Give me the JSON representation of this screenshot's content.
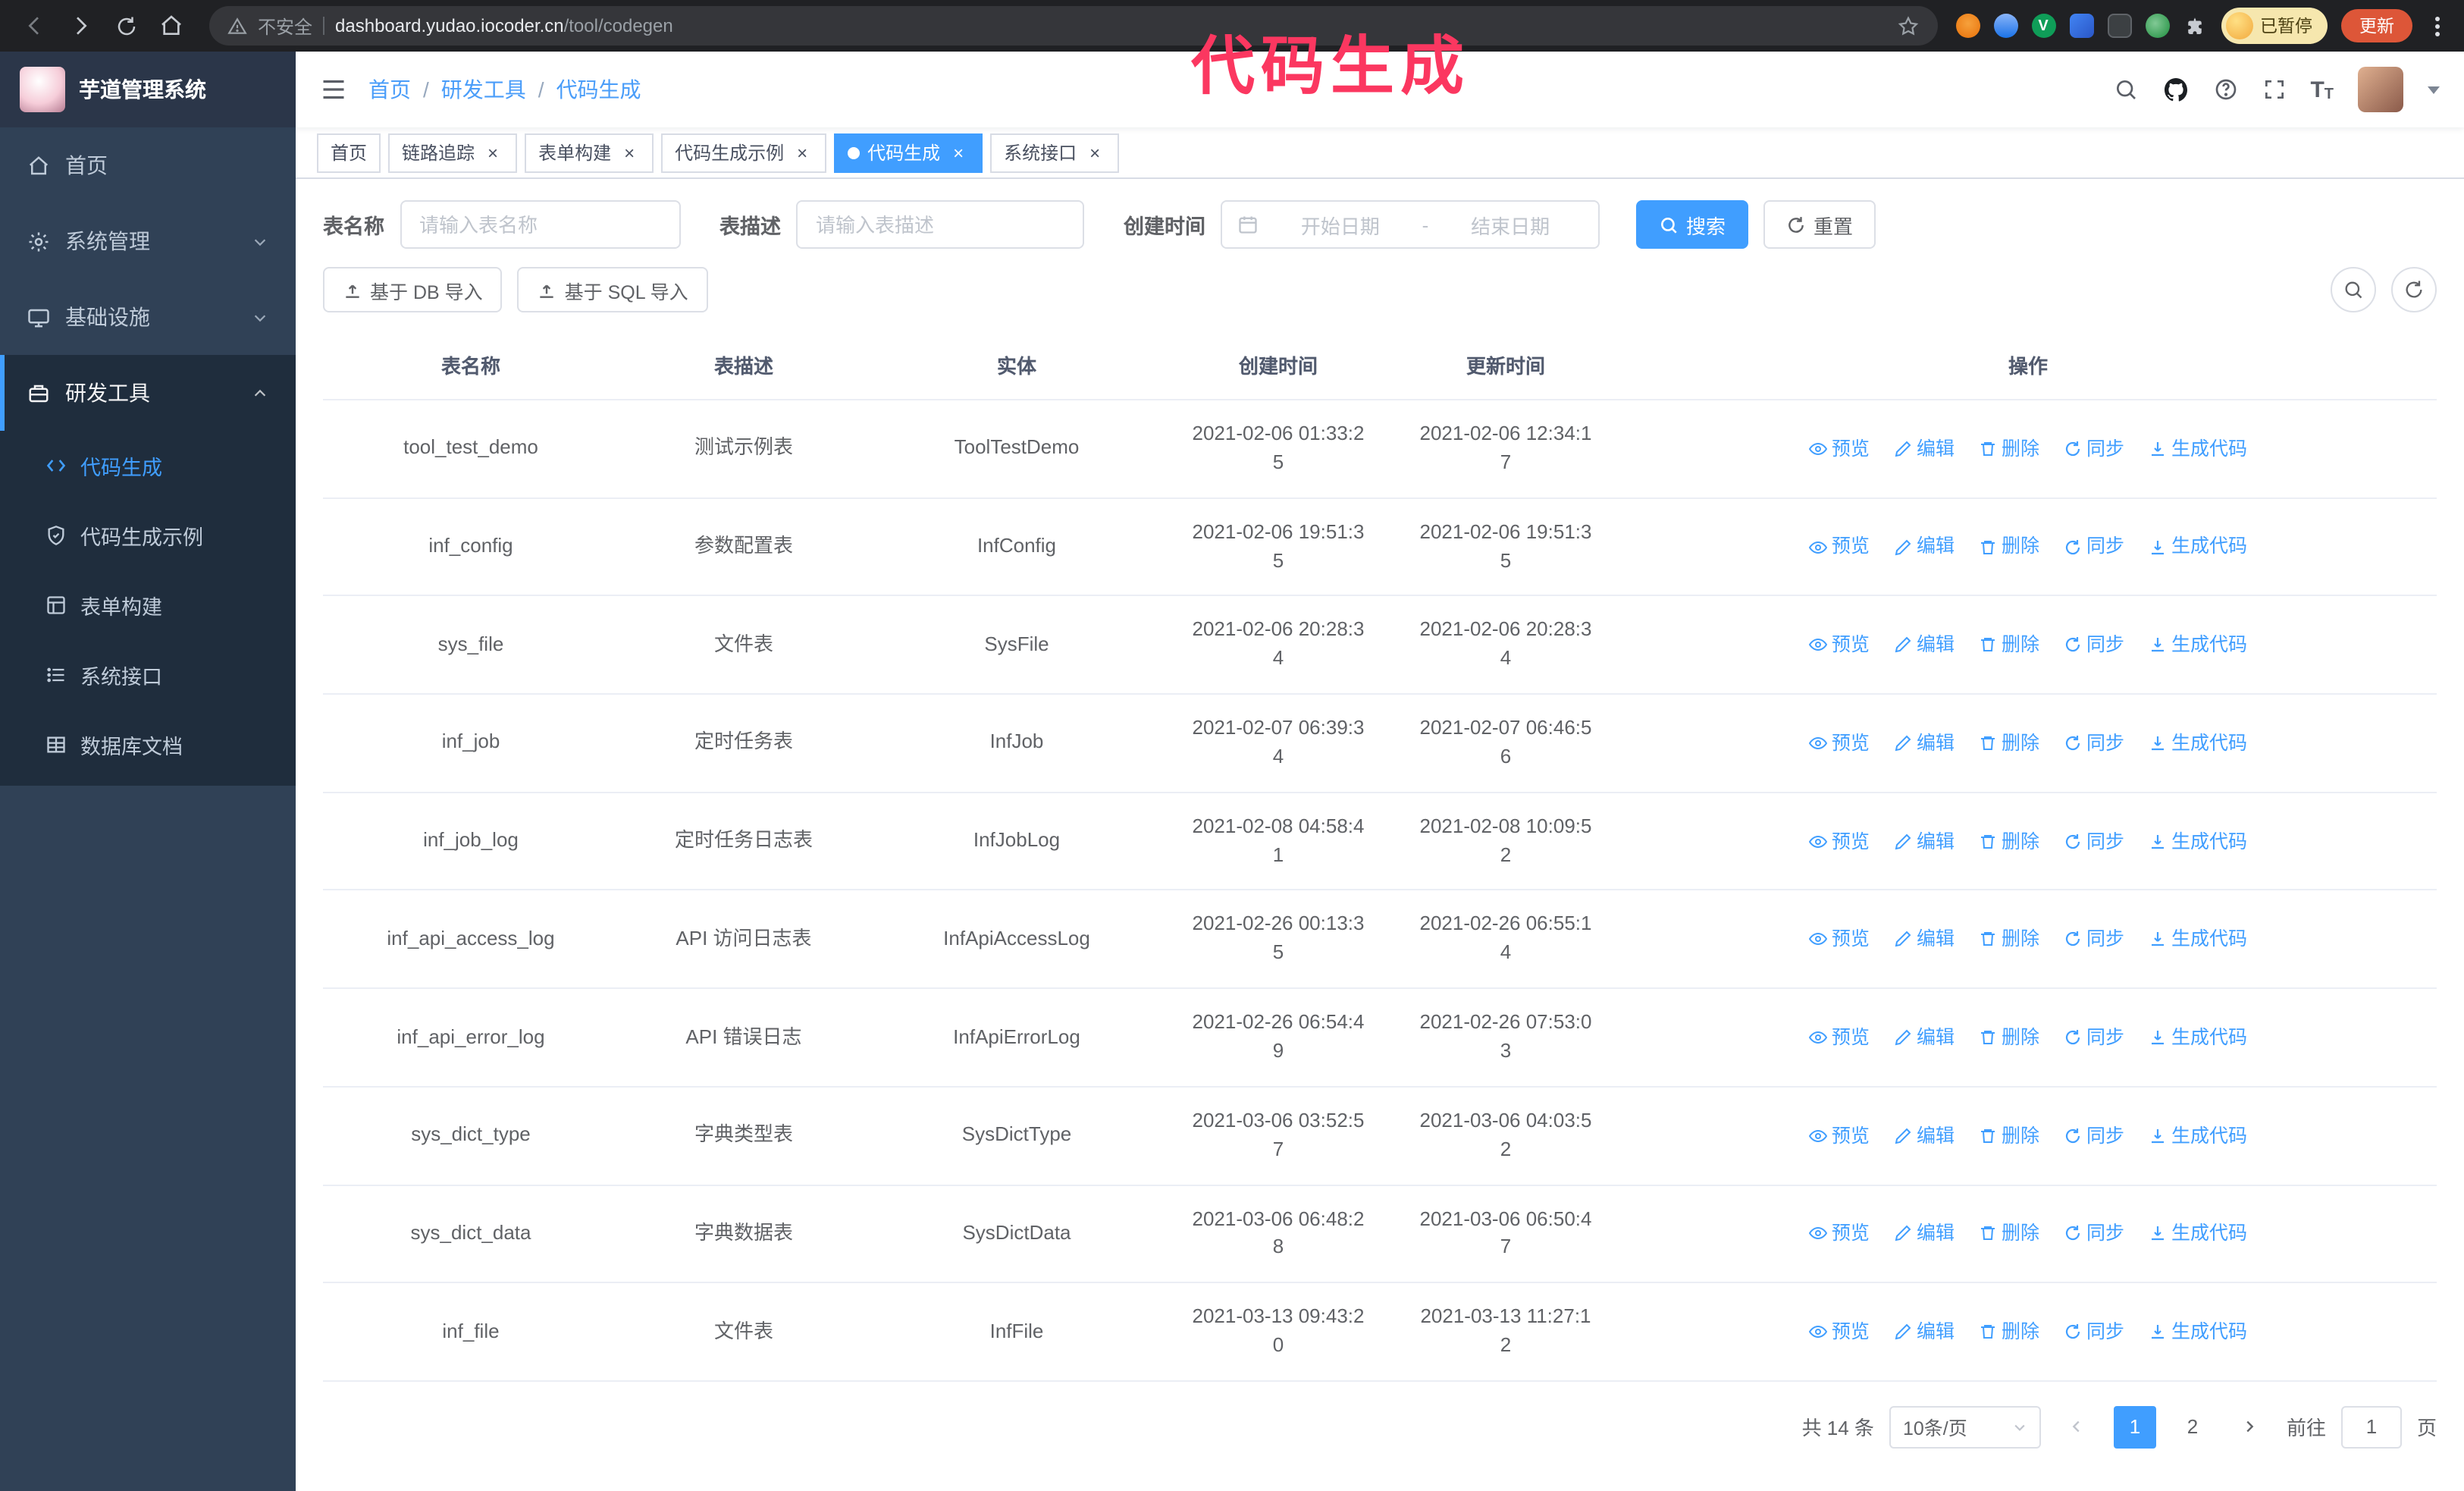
{
  "annotation": {
    "text": "代码生成",
    "color": "#fb3760"
  },
  "icons": {
    "close": "×"
  },
  "colors": {
    "accent": "#409EFF",
    "sidebar_bg": "#304156",
    "submenu_bg": "#1f2d3d",
    "update_button": "#dd5638"
  },
  "browser": {
    "security_label": "不安全",
    "url_host": "dashboard.yudao.iocoder.cn",
    "url_path": "/tool/codegen",
    "paused_badge": "已暂停",
    "update_button": "更新"
  },
  "sidebar": {
    "logo_title": "芋道管理系统",
    "items": [
      {
        "label": "首页",
        "icon": "home-icon"
      },
      {
        "label": "系统管理",
        "icon": "gear-icon"
      },
      {
        "label": "基础设施",
        "icon": "monitor-icon"
      },
      {
        "label": "研发工具",
        "icon": "toolbox-icon"
      }
    ],
    "submenu": [
      {
        "label": "代码生成",
        "icon": "code-icon",
        "active": true
      },
      {
        "label": "代码生成示例",
        "icon": "shield-icon"
      },
      {
        "label": "表单构建",
        "icon": "form-icon"
      },
      {
        "label": "系统接口",
        "icon": "list-icon"
      },
      {
        "label": "数据库文档",
        "icon": "table-grid-icon"
      }
    ]
  },
  "header": {
    "breadcrumb": [
      "首页",
      "研发工具",
      "代码生成"
    ],
    "separator": "/"
  },
  "tabs": [
    {
      "label": "首页",
      "closable": false
    },
    {
      "label": "链路追踪",
      "closable": true
    },
    {
      "label": "表单构建",
      "closable": true
    },
    {
      "label": "代码生成示例",
      "closable": true
    },
    {
      "label": "代码生成",
      "closable": true,
      "active": true
    },
    {
      "label": "系统接口",
      "closable": true
    }
  ],
  "filters": {
    "table_name_label": "表名称",
    "table_name_placeholder": "请输入表名称",
    "table_desc_label": "表描述",
    "table_desc_placeholder": "请输入表描述",
    "create_time_label": "创建时间",
    "date_start_placeholder": "开始日期",
    "date_separator": "-",
    "date_end_placeholder": "结束日期",
    "search_button": "搜索",
    "reset_button": "重置"
  },
  "toolbar": {
    "import_db_button": "基于 DB 导入",
    "import_sql_button": "基于 SQL 导入"
  },
  "table": {
    "columns": [
      "表名称",
      "表描述",
      "实体",
      "创建时间",
      "更新时间",
      "操作"
    ],
    "actions": [
      "预览",
      "编辑",
      "删除",
      "同步",
      "生成代码"
    ],
    "rows": [
      {
        "name": "tool_test_demo",
        "desc": "测试示例表",
        "entity": "ToolTestDemo",
        "created": "2021-02-06 01:33:25",
        "updated": "2021-02-06 12:34:17"
      },
      {
        "name": "inf_config",
        "desc": "参数配置表",
        "entity": "InfConfig",
        "created": "2021-02-06 19:51:35",
        "updated": "2021-02-06 19:51:35"
      },
      {
        "name": "sys_file",
        "desc": "文件表",
        "entity": "SysFile",
        "created": "2021-02-06 20:28:34",
        "updated": "2021-02-06 20:28:34"
      },
      {
        "name": "inf_job",
        "desc": "定时任务表",
        "entity": "InfJob",
        "created": "2021-02-07 06:39:34",
        "updated": "2021-02-07 06:46:56"
      },
      {
        "name": "inf_job_log",
        "desc": "定时任务日志表",
        "entity": "InfJobLog",
        "created": "2021-02-08 04:58:41",
        "updated": "2021-02-08 10:09:52"
      },
      {
        "name": "inf_api_access_log",
        "desc": "API 访问日志表",
        "entity": "InfApiAccessLog",
        "created": "2021-02-26 00:13:35",
        "updated": "2021-02-26 06:55:14"
      },
      {
        "name": "inf_api_error_log",
        "desc": "API 错误日志",
        "entity": "InfApiErrorLog",
        "created": "2021-02-26 06:54:49",
        "updated": "2021-02-26 07:53:03"
      },
      {
        "name": "sys_dict_type",
        "desc": "字典类型表",
        "entity": "SysDictType",
        "created": "2021-03-06 03:52:57",
        "updated": "2021-03-06 04:03:52"
      },
      {
        "name": "sys_dict_data",
        "desc": "字典数据表",
        "entity": "SysDictData",
        "created": "2021-03-06 06:48:28",
        "updated": "2021-03-06 06:50:47"
      },
      {
        "name": "inf_file",
        "desc": "文件表",
        "entity": "InfFile",
        "created": "2021-03-13 09:43:20",
        "updated": "2021-03-13 11:27:12"
      }
    ]
  },
  "pagination": {
    "total": "共 14 条",
    "page_size": "10条/页",
    "pages": [
      "1",
      "2"
    ],
    "current_page": "1",
    "goto_prefix": "前往",
    "goto_value": "1",
    "goto_suffix": "页"
  }
}
